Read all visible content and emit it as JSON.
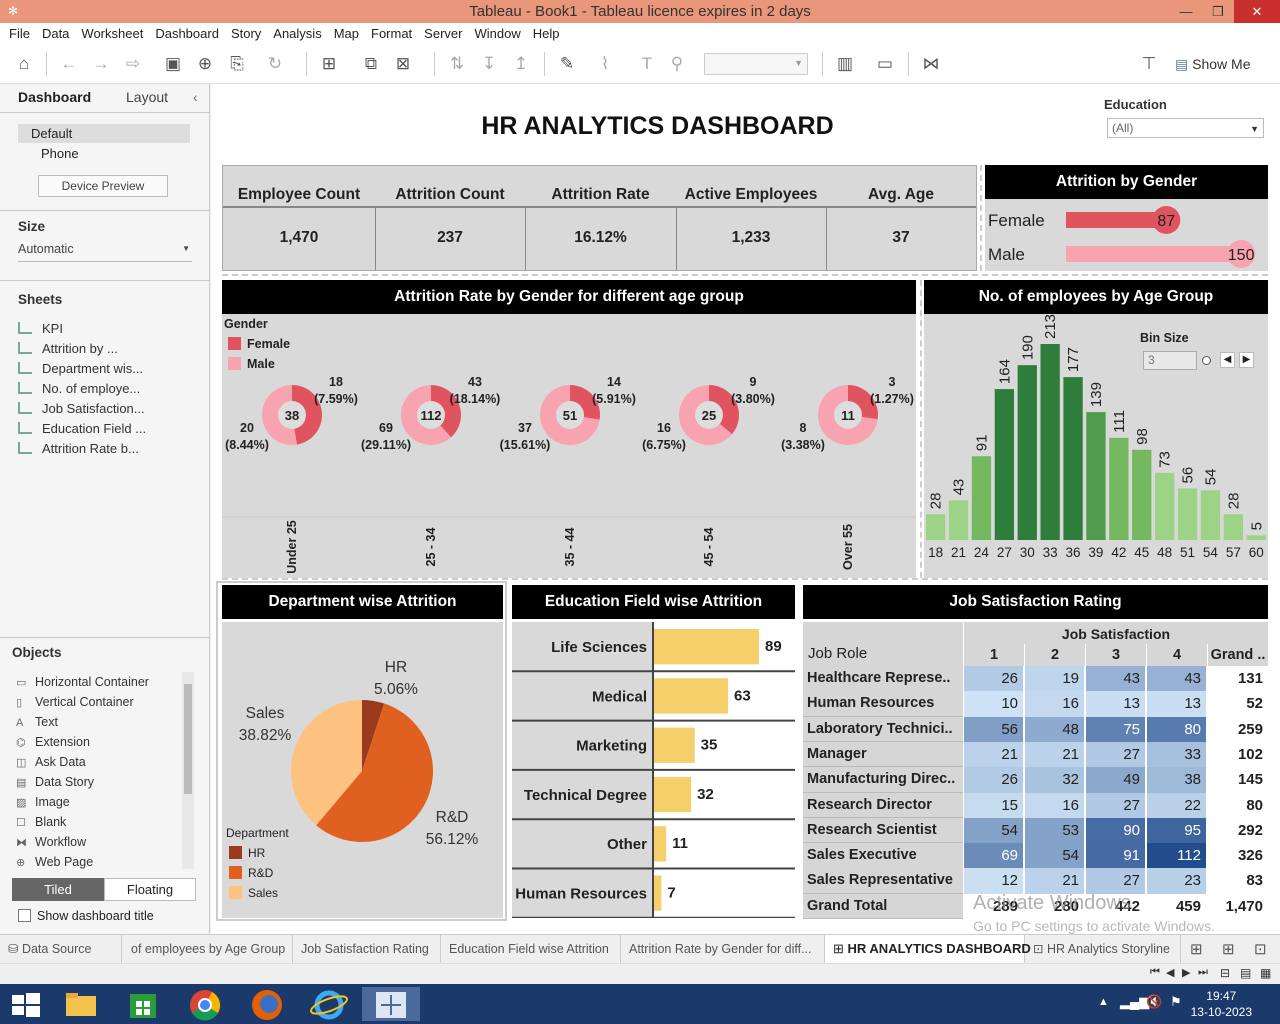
{
  "window": {
    "title": "Tableau - Book1 - Tableau licence expires in 2 days"
  },
  "menu": [
    "File",
    "Data",
    "Worksheet",
    "Dashboard",
    "Story",
    "Analysis",
    "Map",
    "Format",
    "Server",
    "Window",
    "Help"
  ],
  "toolbar": {
    "show_me": "Show Me"
  },
  "left_panel": {
    "tabs": [
      "Dashboard",
      "Layout"
    ],
    "device": {
      "default": "Default",
      "phone": "Phone",
      "preview_button": "Device Preview"
    },
    "size": {
      "heading": "Size",
      "value": "Automatic"
    },
    "sheets": {
      "heading": "Sheets",
      "items": [
        "KPI",
        "Attrition by ...",
        "Department wis...",
        "No. of employe...",
        "Job Satisfaction...",
        "Education Field ...",
        "Attrition Rate b..."
      ]
    },
    "objects": {
      "heading": "Objects",
      "items": [
        "Horizontal Container",
        "Vertical Container",
        "Text",
        "Extension",
        "Ask Data",
        "Data Story",
        "Image",
        "Blank",
        "Workflow",
        "Web Page"
      ]
    },
    "layout_toggle": {
      "tiled": "Tiled",
      "floating": "Floating"
    },
    "show_title": "Show dashboard title"
  },
  "dashboard": {
    "title": "HR ANALYTICS DASHBOARD",
    "filter": {
      "label": "Education",
      "value": "(All)"
    },
    "kpi": {
      "labels": [
        "Employee Count",
        "Attrition Count",
        "Attrition Rate",
        "Active Employees",
        "Avg. Age"
      ],
      "values": [
        "1,470",
        "237",
        "16.12%",
        "1,233",
        "37"
      ]
    },
    "gender_attrition": {
      "title": "Attrition by Gender",
      "rows": [
        {
          "label": "Female",
          "value": 87
        },
        {
          "label": "Male",
          "value": 150
        }
      ]
    },
    "age_gender": {
      "title": "Attrition Rate by Gender for different age group",
      "legend_title": "Gender",
      "legend": [
        "Female",
        "Male"
      ],
      "colors": {
        "female": "#e0545f",
        "male": "#f7a3b0"
      }
    },
    "age_histogram": {
      "title": "No. of employees by Age Group",
      "bin_label": "Bin Size",
      "bin_value": "3"
    },
    "department": {
      "title": "Department wise Attrition",
      "legend_title": "Department",
      "slices": [
        {
          "name": "HR",
          "pct": "5.06%",
          "value": 5.06,
          "color": "#9c3a1e"
        },
        {
          "name": "R&D",
          "pct": "56.12%",
          "value": 56.12,
          "color": "#e0601f"
        },
        {
          "name": "Sales",
          "pct": "38.82%",
          "value": 38.82,
          "color": "#fdc27f"
        }
      ]
    },
    "education_field": {
      "title": "Education Field wise Attrition"
    },
    "job_satisfaction": {
      "title": "Job Satisfaction Rating",
      "col_group": "Job Satisfaction",
      "row_header": "Job Role",
      "columns": [
        "1",
        "2",
        "3",
        "4",
        "Grand .."
      ],
      "rows": [
        {
          "role": "Healthcare Represe..",
          "vals": [
            26,
            19,
            43,
            43
          ],
          "total": "131"
        },
        {
          "role": "Human Resources",
          "vals": [
            10,
            16,
            13,
            13
          ],
          "total": "52"
        },
        {
          "role": "Laboratory Technici..",
          "vals": [
            56,
            48,
            75,
            80
          ],
          "total": "259"
        },
        {
          "role": "Manager",
          "vals": [
            21,
            21,
            27,
            33
          ],
          "total": "102"
        },
        {
          "role": "Manufacturing Direc..",
          "vals": [
            26,
            32,
            49,
            38
          ],
          "total": "145"
        },
        {
          "role": "Research Director",
          "vals": [
            15,
            16,
            27,
            22
          ],
          "total": "80"
        },
        {
          "role": "Research Scientist",
          "vals": [
            54,
            53,
            90,
            95
          ],
          "total": "292"
        },
        {
          "role": "Sales Executive",
          "vals": [
            69,
            54,
            91,
            112
          ],
          "total": "326"
        },
        {
          "role": "Sales Representative",
          "vals": [
            12,
            21,
            27,
            23
          ],
          "total": "83"
        }
      ],
      "grand": {
        "label": "Grand Total",
        "vals": [
          "289",
          "280",
          "442",
          "459"
        ],
        "total": "1,470"
      }
    }
  },
  "chart_data": [
    {
      "type": "pie",
      "title": "Attrition Rate by Gender for different age group",
      "categories": [
        "Under 25",
        "25 - 34",
        "35 - 44",
        "45 - 54",
        "Over 55"
      ],
      "totals": [
        38,
        112,
        51,
        25,
        11
      ],
      "series": [
        {
          "name": "Female",
          "values": [
            18,
            43,
            14,
            9,
            3
          ],
          "labels": [
            "(7.59%)",
            "(18.14%)",
            "(5.91%)",
            "(3.80%)",
            "(1.27%)"
          ]
        },
        {
          "name": "Male",
          "values": [
            20,
            69,
            37,
            16,
            8
          ],
          "labels": [
            "(8.44%)",
            "(29.11%)",
            "(15.61%)",
            "(6.75%)",
            "(3.38%)"
          ]
        }
      ]
    },
    {
      "type": "bar",
      "title": "No. of employees by Age Group",
      "categories": [
        "18",
        "21",
        "24",
        "27",
        "30",
        "33",
        "36",
        "39",
        "42",
        "45",
        "48",
        "51",
        "54",
        "57",
        "60"
      ],
      "values": [
        28,
        43,
        91,
        164,
        190,
        213,
        177,
        139,
        111,
        98,
        73,
        56,
        54,
        28,
        5
      ],
      "ylim": [
        0,
        220
      ]
    },
    {
      "type": "pie",
      "title": "Department wise Attrition",
      "categories": [
        "HR",
        "R&D",
        "Sales"
      ],
      "values": [
        5.06,
        56.12,
        38.82
      ]
    },
    {
      "type": "bar",
      "title": "Education Field wise Attrition",
      "categories": [
        "Life Sciences",
        "Medical",
        "Marketing",
        "Technical Degree",
        "Other",
        "Human Resources"
      ],
      "values": [
        89,
        63,
        35,
        32,
        11,
        7
      ]
    },
    {
      "type": "bar",
      "title": "Attrition by Gender",
      "categories": [
        "Female",
        "Male"
      ],
      "values": [
        87,
        150
      ]
    }
  ],
  "tabs": [
    "Data Source",
    "of employees by Age Group",
    "Job Satisfaction Rating",
    "Education Field wise Attrition",
    "Attrition Rate by Gender for diff...",
    "HR ANALYTICS DASHBOARD",
    "HR Analytics Storyline"
  ],
  "watermark": {
    "line1": "Activate Windows",
    "line2": "Go to PC settings to activate Windows."
  },
  "clock": {
    "time": "19:47",
    "date": "13-10-2023"
  }
}
